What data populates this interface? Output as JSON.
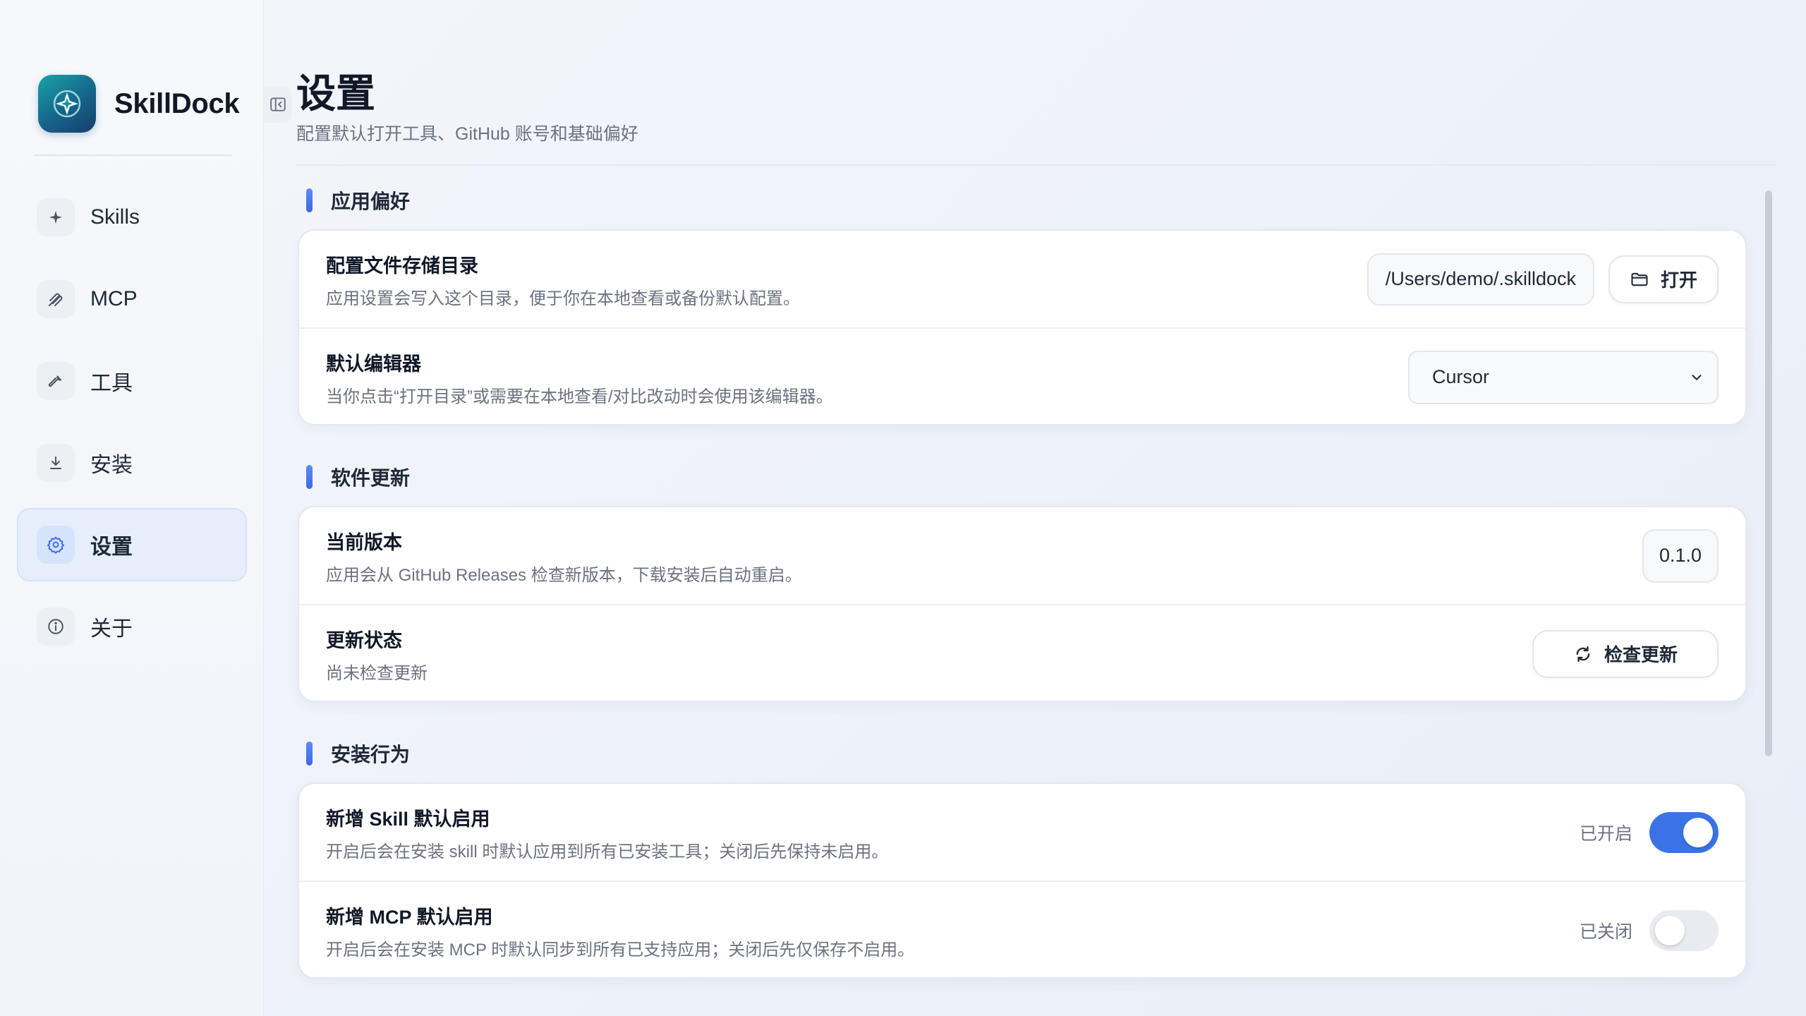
{
  "app": {
    "name": "SkillDock"
  },
  "sidebar": {
    "items": [
      {
        "label": "Skills",
        "icon": "sparkle-icon"
      },
      {
        "label": "MCP",
        "icon": "plug-icon"
      },
      {
        "label": "工具",
        "icon": "wrench-icon"
      },
      {
        "label": "安装",
        "icon": "download-icon"
      },
      {
        "label": "设置",
        "icon": "gear-icon",
        "active": true
      },
      {
        "label": "关于",
        "icon": "info-icon"
      }
    ]
  },
  "page": {
    "title": "设置",
    "subtitle": "配置默认打开工具、GitHub 账号和基础偏好"
  },
  "sections": {
    "app_prefs": {
      "title": "应用偏好",
      "config_dir": {
        "title": "配置文件存储目录",
        "desc": "应用设置会写入这个目录，便于你在本地查看或备份默认配置。",
        "path": "/Users/demo/.skilldock",
        "open_label": "打开"
      },
      "editor": {
        "title": "默认编辑器",
        "desc": "当你点击“打开目录”或需要在本地查看/对比改动时会使用该编辑器。",
        "selected": "Cursor"
      }
    },
    "updates": {
      "title": "软件更新",
      "version": {
        "title": "当前版本",
        "desc": "应用会从 GitHub Releases 检查新版本，下载安装后自动重启。",
        "value": "0.1.0"
      },
      "status": {
        "title": "更新状态",
        "desc": "尚未检查更新",
        "check_label": "检查更新"
      }
    },
    "install": {
      "title": "安装行为",
      "skill_default": {
        "title": "新增 Skill 默认启用",
        "desc": "开启后会在安装 skill 时默认应用到所有已安装工具；关闭后先保持未启用。",
        "state_label": "已开启",
        "enabled": true
      },
      "mcp_default": {
        "title": "新增 MCP 默认启用",
        "desc": "开启后会在安装 MCP 时默认同步到所有已支持应用；关闭后先仅保存不启用。",
        "state_label": "已关闭",
        "enabled": false
      }
    }
  },
  "colors": {
    "accent": "#3b73e6",
    "active_nav_bg": "#e6eefc"
  }
}
